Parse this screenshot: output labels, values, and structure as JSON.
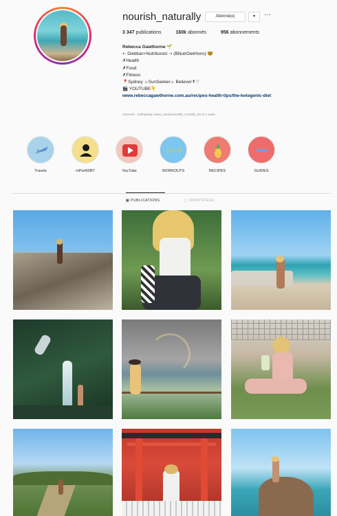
{
  "profile": {
    "username": "nourish_naturally",
    "follow_label": "Abonné(e)",
    "dropdown_label": "▾",
    "more_label": "···"
  },
  "stats": {
    "posts_value": "3 347",
    "posts_label": "publications",
    "followers_value": "160k",
    "followers_label": "abonnés",
    "following_value": "956",
    "following_label": "abonnements"
  },
  "bio": {
    "name": "Rebecca Gawthorne 🌱",
    "line1": "⇠ Dietitian+Nutritionist ⇢ (BNutrDietHons) 🤓",
    "line2": "✗Health",
    "line3": "✗Food",
    "line4": "✗Fitness",
    "line5": "📍Sydney ☼SunSeeker☼ Believer✝♡",
    "line6": "🎬 YOUTUBE👇",
    "link": "www.rebeccagawthorne.com.au/recipes-health-tips/the-ketogenic-diet",
    "followed_by": "Abonnés : earthyandy, eleas, wholesomelife, rochelle_fox et 1 autre"
  },
  "highlights": [
    {
      "label": "Travels",
      "color": "#a9d3ea"
    },
    {
      "label": "mPort60BT",
      "color": "#f4e08a"
    },
    {
      "label": "YouTube",
      "color": "#f2c7bf"
    },
    {
      "label": "WORKOUTS",
      "color": "#7cc6f0"
    },
    {
      "label": "RECIPES",
      "color": "#ef7b72"
    },
    {
      "label": "GUIDES",
      "color": "#ef6c6c"
    }
  ],
  "tabs": {
    "publications": "▦ PUBLICATIONS",
    "identified": "▢ IDENTIFIÉ(E)"
  }
}
